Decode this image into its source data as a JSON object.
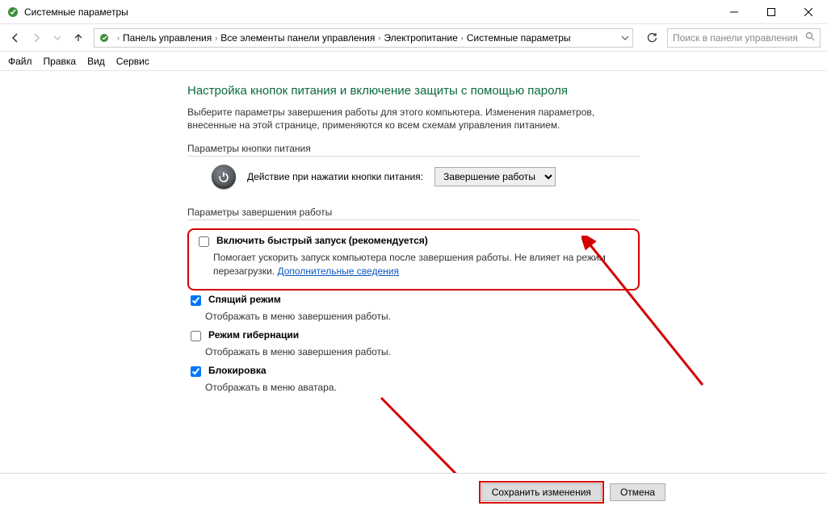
{
  "window": {
    "title": "Системные параметры"
  },
  "breadcrumb": [
    "Панель управления",
    "Все элементы панели управления",
    "Электропитание",
    "Системные параметры"
  ],
  "search": {
    "placeholder": "Поиск в панели управления"
  },
  "menu": [
    "Файл",
    "Правка",
    "Вид",
    "Сервис"
  ],
  "page": {
    "heading": "Настройка кнопок питания и включение защиты с помощью пароля",
    "desc": "Выберите параметры завершения работы для этого компьютера. Изменения параметров, внесенные на этой странице, применяются ко всем схемам управления питанием.",
    "group_power": "Параметры кнопки питания",
    "power_label": "Действие при нажатии кнопки питания:",
    "power_value": "Завершение работы",
    "group_shutdown": "Параметры завершения работы",
    "opt_faststart_label": "Включить быстрый запуск (рекомендуется)",
    "opt_faststart_desc_pre": "Помогает ускорить запуск компьютера после завершения работы. Не влияет на режим перезагрузки. ",
    "opt_faststart_link": "Дополнительные сведения",
    "opt_sleep_label": "Спящий режим",
    "opt_sleep_desc": "Отображать в меню завершения работы.",
    "opt_hibernate_label": "Режим гибернации",
    "opt_hibernate_desc": "Отображать в меню завершения работы.",
    "opt_lock_label": "Блокировка",
    "opt_lock_desc": "Отображать в меню аватара."
  },
  "footer": {
    "save": "Сохранить изменения",
    "cancel": "Отмена"
  }
}
